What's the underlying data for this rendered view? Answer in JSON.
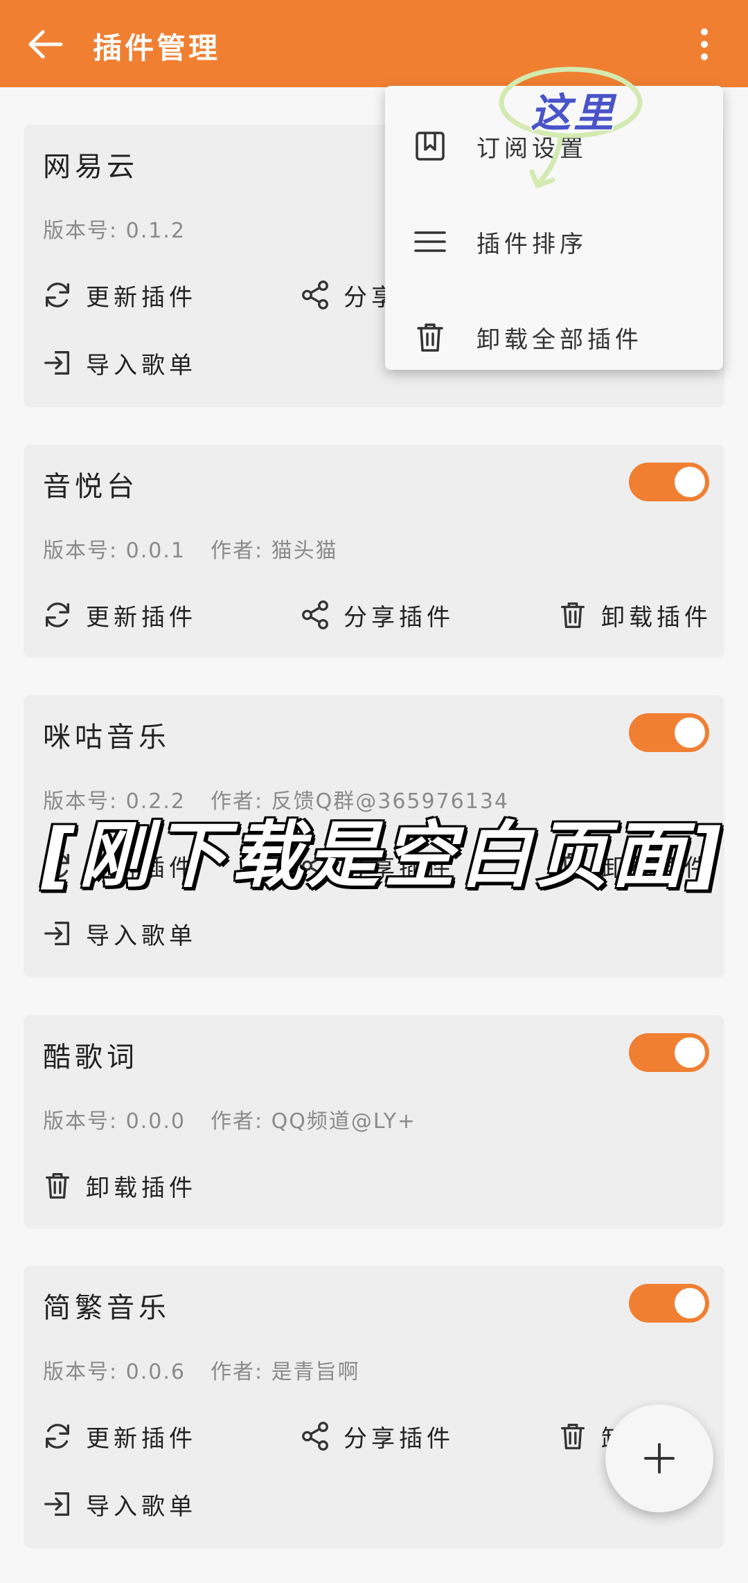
{
  "appbar": {
    "title": "插件管理",
    "back_icon": "arrow-left-icon",
    "more_icon": "more-vert-icon"
  },
  "accent_color": "#f07f32",
  "actions": {
    "update": "更新插件",
    "share": "分享插件",
    "uninstall": "卸载插件",
    "import": "导入歌单",
    "share_partial": "分享"
  },
  "plugins": [
    {
      "name": "网易云",
      "version": "版本号: 0.1.2",
      "author": ""
    },
    {
      "name": "音悦台",
      "version": "版本号: 0.0.1",
      "author": "作者: 猫头猫"
    },
    {
      "name": "咪咕音乐",
      "version": "版本号: 0.2.2",
      "author": "作者: 反馈Q群@365976134"
    },
    {
      "name": "酷歌词",
      "version": "版本号: 0.0.0",
      "author": "作者: QQ频道@LY+"
    },
    {
      "name": "简繁音乐",
      "version": "版本号: 0.0.6",
      "author": "作者: 是青旨啊"
    }
  ],
  "menu": {
    "items": [
      {
        "label": "订阅设置",
        "icon": "bookmark-icon"
      },
      {
        "label": "插件排序",
        "icon": "sort-icon"
      },
      {
        "label": "卸载全部插件",
        "icon": "trash-icon"
      }
    ]
  },
  "annotation": {
    "text": "这里"
  },
  "overlay": {
    "text": "[刚下载是空白页面]"
  },
  "fab": {
    "icon": "plus-icon"
  }
}
